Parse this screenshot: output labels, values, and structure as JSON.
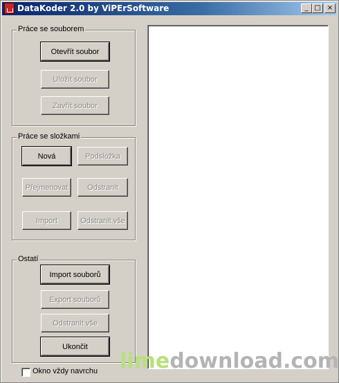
{
  "window": {
    "title": "DataKoder 2.0 by ViPErSoftware"
  },
  "files": {
    "label": "Práce se souborem",
    "open": "Otevřít soubor",
    "save": "Uložit soubor",
    "close": "Zavřít soubor"
  },
  "folders": {
    "label": "Práce se složkami",
    "new": "Nová",
    "subfolder": "Podsložka",
    "rename": "Přejmenovat",
    "remove": "Odstranit",
    "import": "Import",
    "remove_all": "Odstranit vše"
  },
  "other": {
    "label": "Ostatí",
    "import_files": "Import souborů",
    "export_files": "Export souborů",
    "remove_all": "Odstranit vše",
    "exit": "Ukončit"
  },
  "always_on_top": {
    "label": "Okno vždy navrchu",
    "checked": false
  },
  "watermark": {
    "part1": "lime",
    "part2": "download.com"
  }
}
